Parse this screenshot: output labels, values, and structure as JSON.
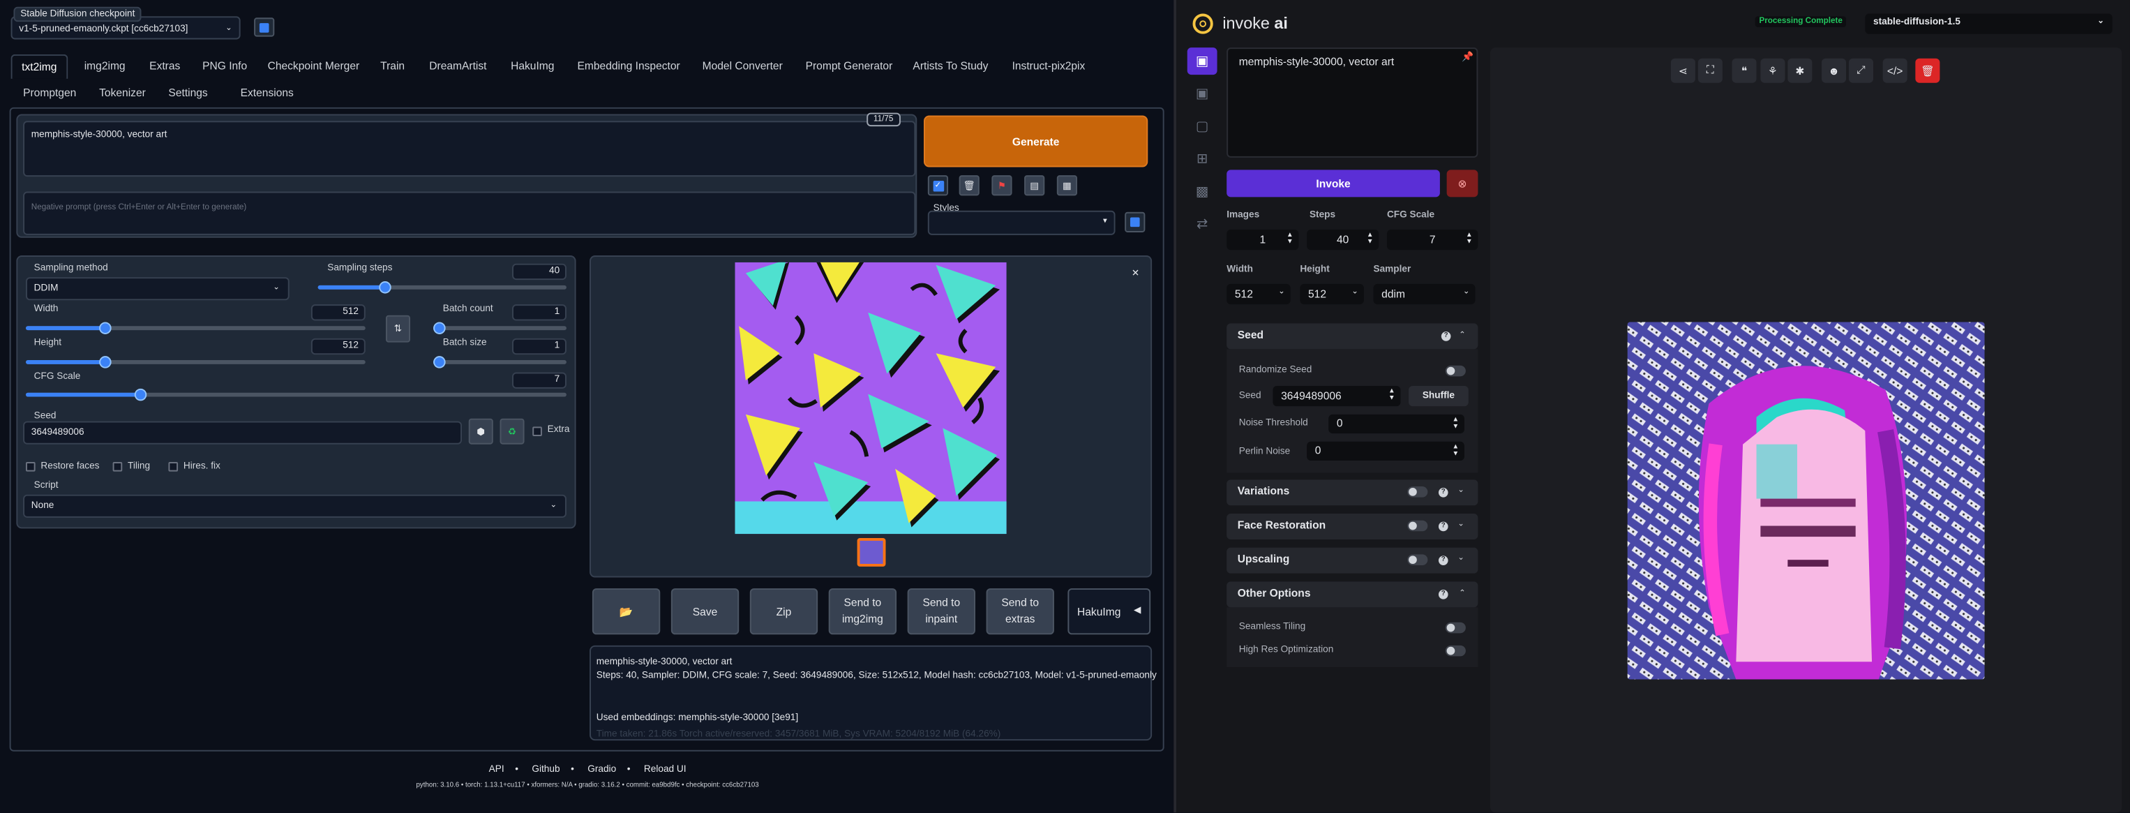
{
  "a1111": {
    "checkpoint_label": "Stable Diffusion checkpoint",
    "checkpoint_value": "v1-5-pruned-emaonly.ckpt [cc6cb27103]",
    "tabs_row1": [
      "txt2img",
      "img2img",
      "Extras",
      "PNG Info",
      "Checkpoint Merger",
      "Train",
      "DreamArtist",
      "HakuImg",
      "Embedding Inspector",
      "Model Converter",
      "Prompt Generator",
      "Artists To Study",
      "Instruct-pix2pix"
    ],
    "tabs_row2": [
      "Promptgen",
      "Tokenizer",
      "Settings",
      "Extensions"
    ],
    "prompt": "memphis-style-30000, vector art",
    "token_counter": "11/75",
    "negative_placeholder": "Negative prompt (press Ctrl+Enter or Alt+Enter to generate)",
    "generate_label": "Generate",
    "styles_label": "Styles",
    "sampling_method_label": "Sampling method",
    "sampling_method_value": "DDIM",
    "sampling_steps_label": "Sampling steps",
    "sampling_steps_value": "40",
    "width_label": "Width",
    "width_value": "512",
    "height_label": "Height",
    "height_value": "512",
    "batch_count_label": "Batch count",
    "batch_count_value": "1",
    "batch_size_label": "Batch size",
    "batch_size_value": "1",
    "cfg_label": "CFG Scale",
    "cfg_value": "7",
    "seed_label": "Seed",
    "seed_value": "3649489006",
    "extra_label": "Extra",
    "restore_faces_label": "Restore faces",
    "tiling_label": "Tiling",
    "hires_label": "Hires. fix",
    "script_label": "Script",
    "script_value": "None",
    "actions": {
      "folder": "📂",
      "save": "Save",
      "zip": "Zip",
      "send_img2img": "Send to img2img",
      "send_inpaint": "Send to inpaint",
      "send_extras": "Send to extras",
      "hakuimg": "HakuImg"
    },
    "info_prompt": "memphis-style-30000, vector art",
    "info_params": "Steps: 40, Sampler: DDIM, CFG scale: 7, Seed: 3649489006, Size: 512x512, Model hash: cc6cb27103, Model: v1-5-pruned-emaonly",
    "info_embeddings": "Used embeddings: memphis-style-30000 [3e91]",
    "info_time": "Time taken: 21.86s  Torch active/reserved: 3457/3681 MiB, Sys VRAM: 5204/8192 MiB (64.26%)",
    "footer_links": [
      "API",
      "Github",
      "Gradio",
      "Reload UI"
    ],
    "footer_versions": "python: 3.10.6  •  torch: 1.13.1+cu117  •  xformers: N/A  •  gradio: 3.16.2  •  commit: ea9bd9fc  •  checkpoint: cc6cb27103",
    "slider_levels": {
      "sampling_steps": 0.27,
      "width": 0.23,
      "height": 0.23,
      "batch_count": 0.0,
      "batch_size": 0.0,
      "cfg": 0.21
    }
  },
  "invoke": {
    "brand_text": "invoke",
    "brand_ai": "ai",
    "status": "Processing Complete",
    "model": "stable-diffusion-1.5",
    "prompt": "memphis-style-30000, vector art",
    "invoke_label": "Invoke",
    "images_label": "Images",
    "images_value": "1",
    "steps_label": "Steps",
    "steps_value": "40",
    "cfg_label": "CFG Scale",
    "cfg_value": "7",
    "width_label": "Width",
    "width_value": "512",
    "height_label": "Height",
    "height_value": "512",
    "sampler_label": "Sampler",
    "sampler_value": "ddim",
    "seed_section": "Seed",
    "randomize_seed_label": "Randomize Seed",
    "seed_label": "Seed",
    "seed_value": "3649489006",
    "shuffle_label": "Shuffle",
    "noise_threshold_label": "Noise Threshold",
    "noise_threshold_value": "0",
    "perlin_label": "Perlin Noise",
    "perlin_value": "0",
    "sections": [
      "Variations",
      "Face Restoration",
      "Upscaling"
    ],
    "other_options": "Other Options",
    "seamless_label": "Seamless Tiling",
    "highres_label": "High Res Optimization",
    "colors": {
      "accent": "#5b2fd6",
      "status": "#22c55e",
      "danger": "#dc2626"
    }
  }
}
